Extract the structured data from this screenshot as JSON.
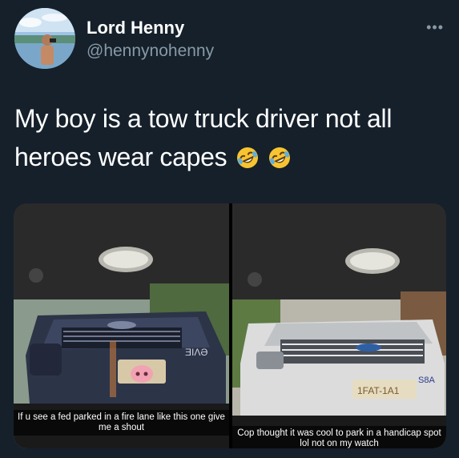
{
  "tweet": {
    "display_name": "Lord Henny",
    "handle": "@hennynohenny",
    "more_icon": "•••",
    "text": "My boy is a tow truck driver not all heroes wear capes",
    "emoji_icon": "rolling-on-the-floor-laughing-icon",
    "emoji_count": 2
  },
  "media": {
    "left_photo": {
      "caption": "If u see a fed parked in a fire lane like this one give me a shout",
      "plate_text": "ƎIΛƏ"
    },
    "right_photo": {
      "caption": "Cop thought it was cool to park in a handicap spot lol not on my watch",
      "plate_text": "1FAT-1A1",
      "plate_tag": "S8A"
    }
  },
  "colors": {
    "background": "#15202b",
    "secondary_text": "#8899a6",
    "primary_text": "#ffffff"
  }
}
